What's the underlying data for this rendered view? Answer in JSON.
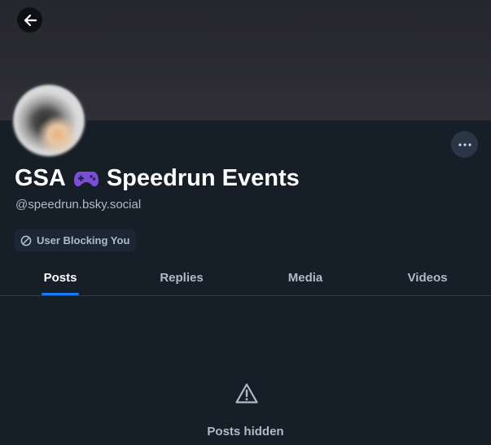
{
  "profile": {
    "display_name_prefix": "GSA",
    "display_name_emoji_icon": "game-controller-icon",
    "display_name_suffix": "Speedrun Events",
    "handle": "@speedrun.bsky.social",
    "block_badge_label": "User Blocking You"
  },
  "tabs": [
    {
      "label": "Posts",
      "active": true
    },
    {
      "label": "Replies",
      "active": false
    },
    {
      "label": "Media",
      "active": false
    },
    {
      "label": "Videos",
      "active": false
    }
  ],
  "empty_state": {
    "icon": "warning-icon",
    "label": "Posts hidden"
  },
  "colors": {
    "background": "#161e27",
    "accent": "#1a7bf7",
    "muted_text": "#aebbc9",
    "emoji_purple": "#7a4fd6"
  }
}
